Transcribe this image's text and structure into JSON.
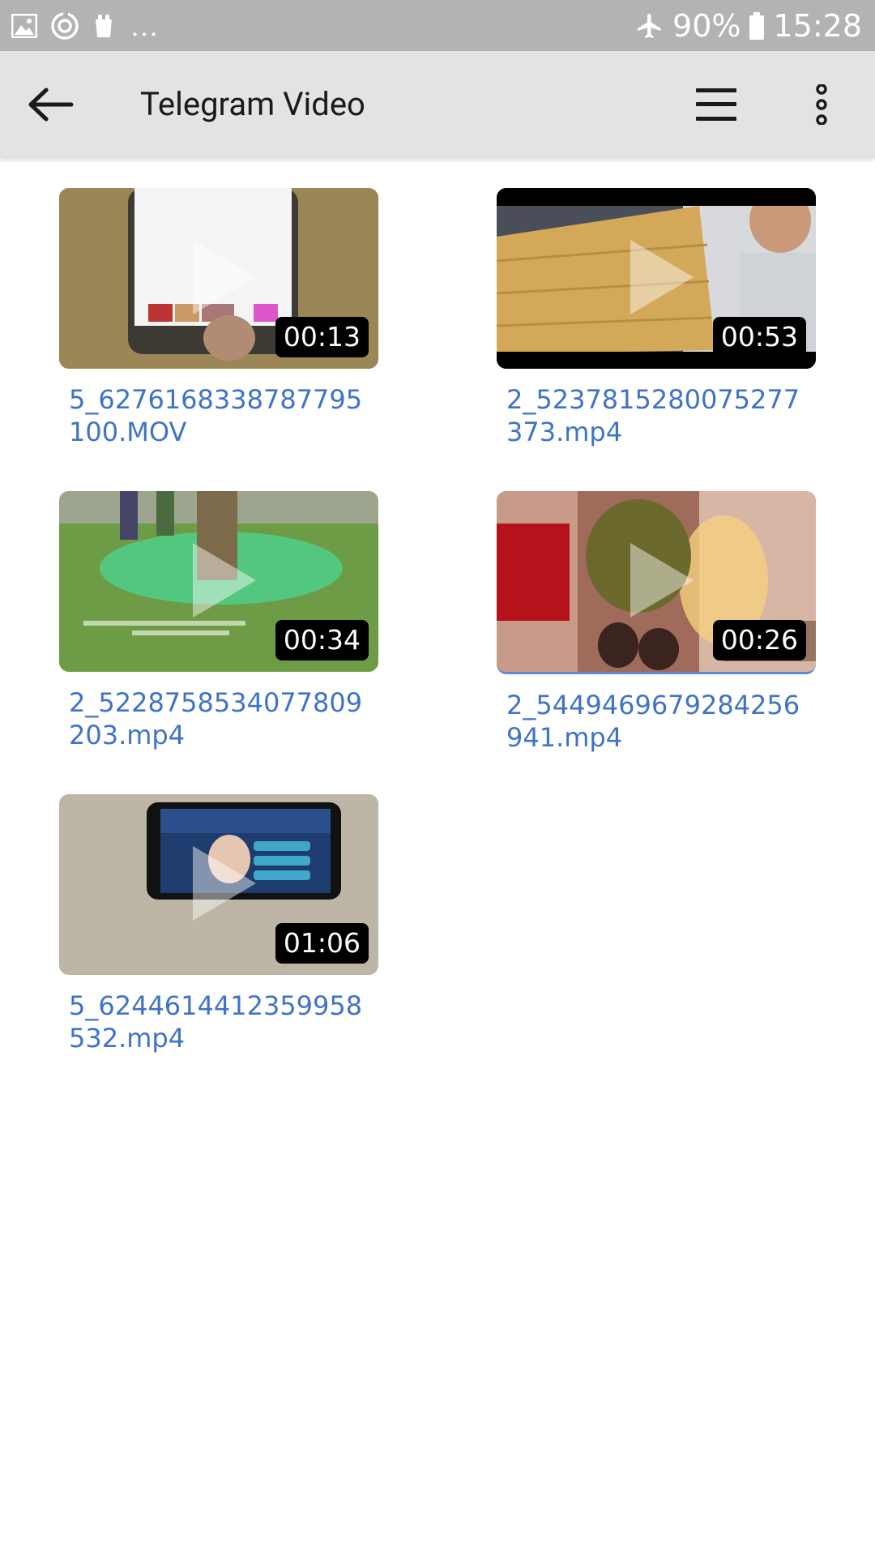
{
  "status_bar": {
    "battery_percent": "90%",
    "time": "15:28",
    "more_notifications": "...",
    "icons": [
      "gallery-icon",
      "sync-icon",
      "app-icon",
      "airplane-icon",
      "battery-icon"
    ]
  },
  "toolbar": {
    "title": "Telegram Video",
    "back_icon": "arrow-left-icon",
    "menu_icon": "hamburger-icon",
    "more_icon": "more-vertical-icon"
  },
  "videos": [
    {
      "filename": "5_6276168338787795100.MOV",
      "duration": "00:13"
    },
    {
      "filename": "2_5237815280075277373.mp4",
      "duration": "00:53"
    },
    {
      "filename": "2_5228758534077809203.mp4",
      "duration": "00:34"
    },
    {
      "filename": "2_5449469679284256941.mp4",
      "duration": "00:26"
    },
    {
      "filename": "5_6244614412359958532.mp4",
      "duration": "01:06"
    }
  ],
  "colors": {
    "status_bar": "#b3b3b3",
    "toolbar": "#e3e3e3",
    "filename_link": "#3f73c8",
    "duration_badge": "#000000"
  }
}
